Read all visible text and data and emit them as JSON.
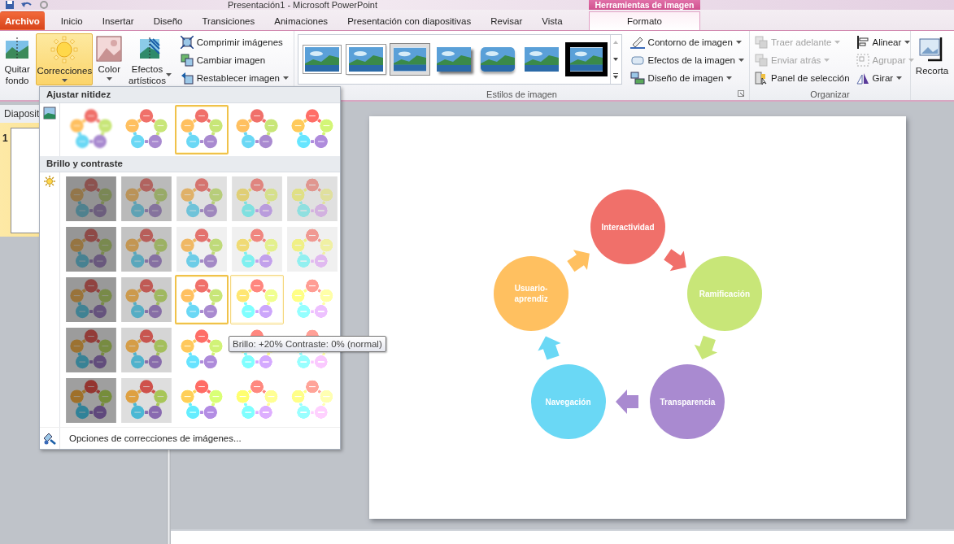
{
  "window": {
    "title": "Presentación1  -  Microsoft PowerPoint"
  },
  "contextual_group": "Herramientas de imagen",
  "tabs": [
    {
      "label": "Archivo",
      "kind": "file",
      "selected": false
    },
    {
      "label": "Inicio",
      "kind": "normal",
      "selected": false
    },
    {
      "label": "Insertar",
      "kind": "normal",
      "selected": false
    },
    {
      "label": "Diseño",
      "kind": "normal",
      "selected": false
    },
    {
      "label": "Transiciones",
      "kind": "normal",
      "selected": false
    },
    {
      "label": "Animaciones",
      "kind": "normal",
      "selected": false
    },
    {
      "label": "Presentación con diapositivas",
      "kind": "normal",
      "selected": false
    },
    {
      "label": "Revisar",
      "kind": "normal",
      "selected": false
    },
    {
      "label": "Vista",
      "kind": "normal",
      "selected": false
    },
    {
      "label": "Formato",
      "kind": "contextual",
      "selected": true
    }
  ],
  "ribbon": {
    "adjust": {
      "buttons": [
        {
          "label": "Quitar fondo",
          "kind": "remove-background",
          "pressed": false,
          "dropdown": false
        },
        {
          "label": "Correcciones",
          "kind": "corrections",
          "pressed": true,
          "dropdown": true
        },
        {
          "label": "Color",
          "kind": "color",
          "pressed": false,
          "dropdown": true
        },
        {
          "label": "Efectos artísticos",
          "kind": "artistic",
          "pressed": false,
          "dropdown": true
        }
      ],
      "commands": [
        {
          "label": "Comprimir imágenes",
          "kind": "compress",
          "dropdown": false
        },
        {
          "label": "Cambiar imagen",
          "kind": "change",
          "dropdown": false
        },
        {
          "label": "Restablecer imagen",
          "kind": "reset",
          "dropdown": true
        }
      ]
    },
    "styles": {
      "label": "Estilos de imagen",
      "gallery": [
        {
          "kind": "simple-frame"
        },
        {
          "kind": "white-frame"
        },
        {
          "kind": "thick-frame"
        },
        {
          "kind": "shadow"
        },
        {
          "kind": "rounded"
        },
        {
          "kind": "soft-edge"
        },
        {
          "kind": "black-frame"
        }
      ],
      "commands": [
        {
          "label": "Contorno de imagen",
          "kind": "border",
          "dropdown": true
        },
        {
          "label": "Efectos de la imagen",
          "kind": "effects",
          "dropdown": true
        },
        {
          "label": "Diseño de imagen",
          "kind": "layout",
          "dropdown": true
        }
      ]
    },
    "arrange": {
      "label": "Organizar",
      "commands": [
        {
          "label": "Traer adelante",
          "kind": "forward",
          "disabled": true,
          "dropdown": true
        },
        {
          "label": "Enviar atrás",
          "kind": "backward",
          "disabled": true,
          "dropdown": true
        },
        {
          "label": "Panel de selección",
          "kind": "selection",
          "disabled": false,
          "dropdown": false
        },
        {
          "label": "Alinear",
          "kind": "align",
          "disabled": false,
          "dropdown": true
        },
        {
          "label": "Agrupar",
          "kind": "group",
          "disabled": true,
          "dropdown": true
        },
        {
          "label": "Girar",
          "kind": "rotate",
          "disabled": false,
          "dropdown": true
        }
      ]
    },
    "crop": {
      "label": "Recorta"
    }
  },
  "slides_panel": {
    "tab": "Diaposit",
    "slides": [
      {
        "number": "1",
        "selected": true
      }
    ]
  },
  "slide": {
    "nodes": [
      {
        "label": "Interactividad",
        "color": "#f0706a"
      },
      {
        "label": "Usuario-aprendiz",
        "color": "#ffc060"
      },
      {
        "label": "Navegación",
        "color": "#6ad8f5"
      },
      {
        "label": "Transparencia",
        "color": "#a98ad0"
      },
      {
        "label": "Ramificación",
        "color": "#c8e678"
      }
    ]
  },
  "menu": {
    "sections": [
      {
        "title": "Ajustar nitidez",
        "kind": "sharpness",
        "rows": [
          [
            {
              "selected": false,
              "hovered": false
            },
            {
              "selected": false,
              "hovered": false
            },
            {
              "selected": true,
              "hovered": false
            },
            {
              "selected": false,
              "hovered": false
            },
            {
              "selected": false,
              "hovered": false
            }
          ]
        ]
      },
      {
        "title": "Brillo y contraste",
        "kind": "brightness",
        "rows": [
          [
            {
              "selected": false,
              "hovered": false
            },
            {
              "selected": false,
              "hovered": false
            },
            {
              "selected": false,
              "hovered": false
            },
            {
              "selected": false,
              "hovered": false
            },
            {
              "selected": false,
              "hovered": false
            }
          ],
          [
            {
              "selected": false,
              "hovered": false
            },
            {
              "selected": false,
              "hovered": false
            },
            {
              "selected": false,
              "hovered": false
            },
            {
              "selected": false,
              "hovered": false
            },
            {
              "selected": false,
              "hovered": false
            }
          ],
          [
            {
              "selected": false,
              "hovered": false
            },
            {
              "selected": false,
              "hovered": false
            },
            {
              "selected": true,
              "hovered": false
            },
            {
              "selected": false,
              "hovered": true
            },
            {
              "selected": false,
              "hovered": false
            }
          ],
          [
            {
              "selected": false,
              "hovered": false
            },
            {
              "selected": false,
              "hovered": false
            },
            {
              "selected": false,
              "hovered": false
            },
            {
              "selected": false,
              "hovered": false
            },
            {
              "selected": false,
              "hovered": false
            }
          ],
          [
            {
              "selected": false,
              "hovered": false
            },
            {
              "selected": false,
              "hovered": false
            },
            {
              "selected": false,
              "hovered": false
            },
            {
              "selected": false,
              "hovered": false
            },
            {
              "selected": false,
              "hovered": false
            }
          ]
        ]
      }
    ],
    "footer": "Opciones de correcciones de imágenes..."
  },
  "tooltip": "Brillo: +20% Contraste: 0% (normal)"
}
